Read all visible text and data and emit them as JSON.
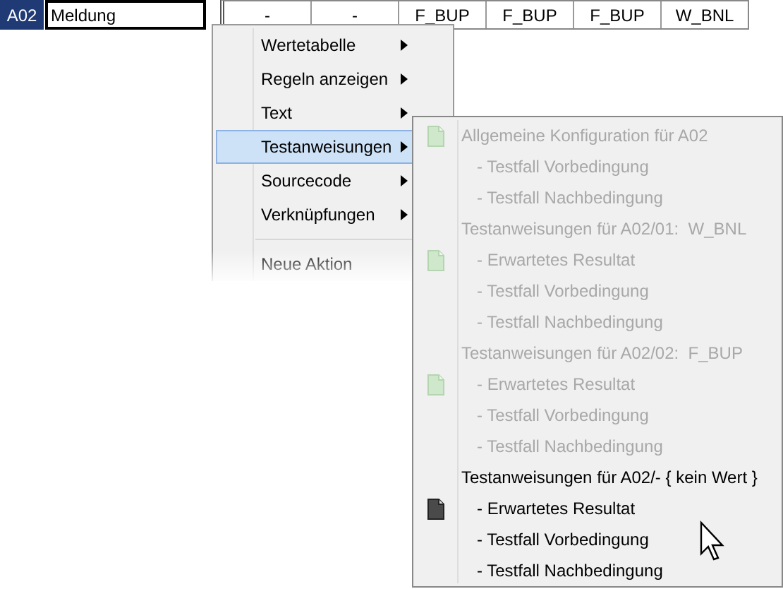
{
  "row": {
    "id": "A02",
    "field_value": "Meldung",
    "cells": [
      "-",
      "-",
      "F_BUP",
      "F_BUP",
      "F_BUP",
      "W_BNL"
    ]
  },
  "context_menu": {
    "items": [
      {
        "kind": "item",
        "label": "Wertetabelle",
        "selected": false,
        "has_submenu": true
      },
      {
        "kind": "item",
        "label": "Regeln anzeigen",
        "selected": false,
        "has_submenu": true
      },
      {
        "kind": "item",
        "label": "Text",
        "selected": false,
        "has_submenu": true
      },
      {
        "kind": "item",
        "label": "Testanweisungen",
        "selected": true,
        "has_submenu": true
      },
      {
        "kind": "item",
        "label": "Sourcecode",
        "selected": false,
        "has_submenu": true
      },
      {
        "kind": "item",
        "label": "Verknüpfungen",
        "selected": false,
        "has_submenu": true
      },
      {
        "kind": "separator"
      },
      {
        "kind": "item",
        "label": "Neue Aktion",
        "selected": false,
        "has_submenu": false
      }
    ]
  },
  "submenu": {
    "items": [
      {
        "kind": "heading",
        "label": "Allgemeine Konfiguration für A02",
        "disabled": true,
        "icon": true
      },
      {
        "kind": "entry",
        "label": "- Testfall Vorbedingung",
        "disabled": true,
        "icon": false
      },
      {
        "kind": "entry",
        "label": "- Testfall Nachbedingung",
        "disabled": true,
        "icon": false
      },
      {
        "kind": "heading",
        "label": "Testanweisungen für A02/01:  W_BNL",
        "disabled": true,
        "icon": false
      },
      {
        "kind": "entry",
        "label": "- Erwartetes Resultat",
        "disabled": true,
        "icon": true
      },
      {
        "kind": "entry",
        "label": "- Testfall Vorbedingung",
        "disabled": true,
        "icon": false
      },
      {
        "kind": "entry",
        "label": "- Testfall Nachbedingung",
        "disabled": true,
        "icon": false
      },
      {
        "kind": "heading",
        "label": "Testanweisungen für A02/02:  F_BUP",
        "disabled": true,
        "icon": false
      },
      {
        "kind": "entry",
        "label": "- Erwartetes Resultat",
        "disabled": true,
        "icon": true
      },
      {
        "kind": "entry",
        "label": "- Testfall Vorbedingung",
        "disabled": true,
        "icon": false
      },
      {
        "kind": "entry",
        "label": "- Testfall Nachbedingung",
        "disabled": true,
        "icon": false
      },
      {
        "kind": "heading",
        "label": "Testanweisungen für A02/- { kein Wert }",
        "disabled": false,
        "icon": false
      },
      {
        "kind": "entry",
        "label": "- Erwartetes Resultat",
        "disabled": false,
        "icon": true
      },
      {
        "kind": "entry",
        "label": "- Testfall Vorbedingung",
        "disabled": false,
        "icon": false
      },
      {
        "kind": "entry",
        "label": "- Testfall Nachbedingung",
        "disabled": false,
        "icon": false
      }
    ]
  }
}
